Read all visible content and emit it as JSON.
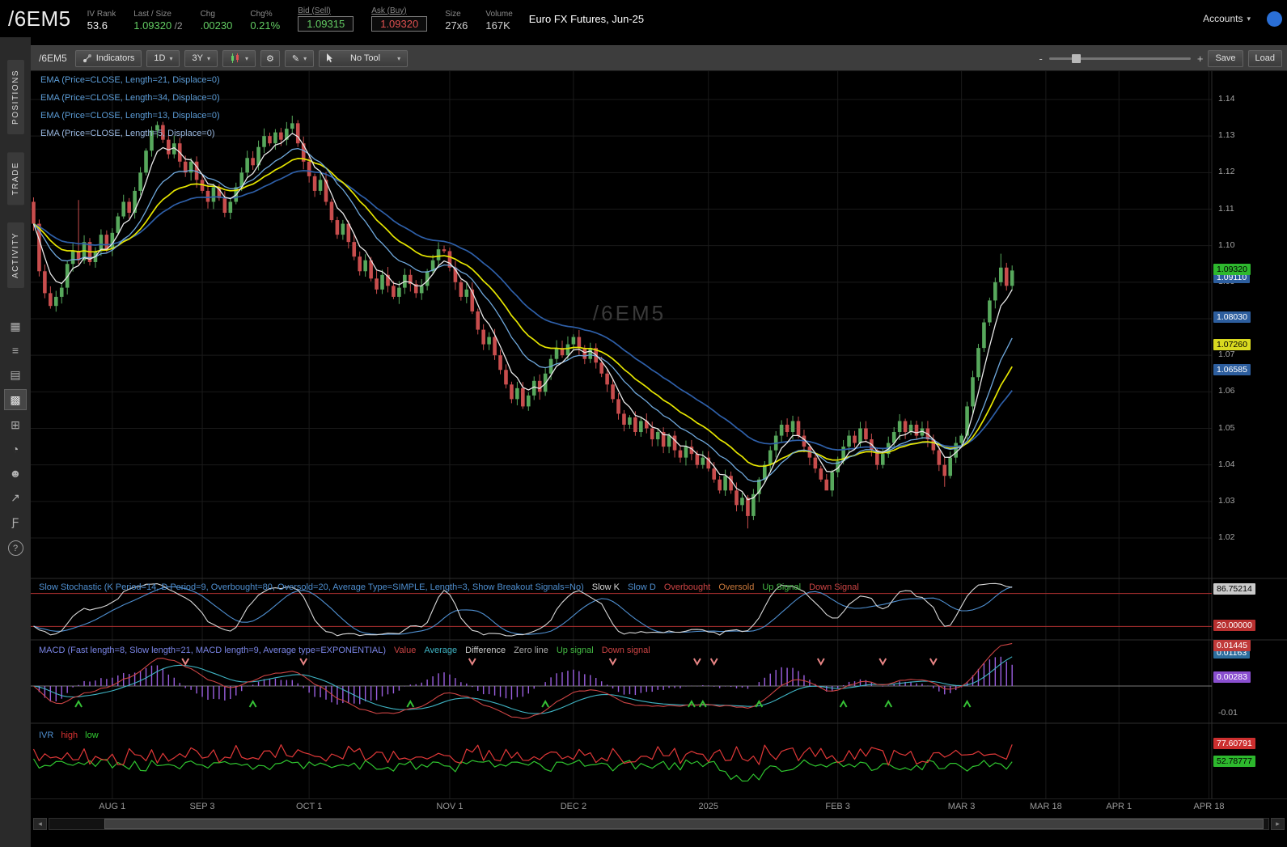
{
  "header": {
    "symbol": "/6EM5",
    "fields": [
      {
        "label": "IV Rank",
        "value": "53.6",
        "color": "white",
        "boxed": false
      },
      {
        "label": "Last / Size",
        "value": "1.09320",
        "suffix": " /2",
        "color": "green",
        "boxed": false
      },
      {
        "label": "Chg",
        "value": ".00230",
        "color": "green",
        "boxed": false
      },
      {
        "label": "Chg%",
        "value": "0.21%",
        "color": "green",
        "boxed": false
      },
      {
        "label": "Bid (Sell)",
        "value": "1.09315",
        "color": "green",
        "boxed": true
      },
      {
        "label": "Ask (Buy)",
        "value": "1.09320",
        "color": "red",
        "boxed": true
      },
      {
        "label": "Size",
        "value": "27x6",
        "color": "gray",
        "boxed": false
      },
      {
        "label": "Volume",
        "value": "167K",
        "color": "gray",
        "boxed": false
      }
    ],
    "description": "Euro FX Futures, Jun-25",
    "accounts_label": "Accounts"
  },
  "sidebar": {
    "tabs": [
      {
        "label": "POSITIONS"
      },
      {
        "label": "TRADE"
      },
      {
        "label": "ACTIVITY"
      }
    ],
    "icons": [
      {
        "name": "calculator-icon",
        "glyph": "▦"
      },
      {
        "name": "watchlist-icon",
        "glyph": "≡"
      },
      {
        "name": "notes-icon",
        "glyph": "▤"
      },
      {
        "name": "charts-icon",
        "glyph": "▩",
        "active": true
      },
      {
        "name": "apps-grid-icon",
        "glyph": "⊞"
      },
      {
        "name": "history-clock-icon",
        "glyph": "◔"
      },
      {
        "name": "community-icon",
        "glyph": "☻"
      },
      {
        "name": "share-export-icon",
        "glyph": "↗"
      },
      {
        "name": "fx-board-icon",
        "glyph": "Ƒ"
      },
      {
        "name": "help-icon",
        "glyph": "?",
        "round": true
      }
    ]
  },
  "toolbar": {
    "symbol": "/6EM5",
    "indicators_label": "Indicators",
    "timeframe": "1D",
    "range": "3Y",
    "tool_label": "No Tool",
    "save_label": "Save",
    "load_label": "Load"
  },
  "icons": {
    "chevron_down": "▾",
    "minus": "-",
    "plus": "+",
    "gear": "⚙",
    "pencil": "✎",
    "scroll_left": "◂",
    "scroll_right": "▸"
  },
  "watermark": "/6EM5",
  "legends": {
    "emas": [
      {
        "text": "EMA (Price=CLOSE, Length=21, Displace=0)",
        "color": "#5b9bd5"
      },
      {
        "text": "EMA (Price=CLOSE, Length=34, Displace=0)",
        "color": "#5b9bd5"
      },
      {
        "text": "EMA (Price=CLOSE, Length=13, Displace=0)",
        "color": "#5b9bd5"
      },
      {
        "text": "EMA (Price=CLOSE, Length=5, Displace=0)",
        "color": "#9ab8e0"
      }
    ],
    "stoch": [
      {
        "text": "Slow Stochastic (K Period=14, D Period=9, Overbought=80, Oversold=20, Average Type=SIMPLE, Length=3, Show Breakout Signals=No)",
        "color": "#4f8fd0"
      },
      {
        "text": "Slow K",
        "color": "#d8d8d8"
      },
      {
        "text": "Slow D",
        "color": "#4f8fd0"
      },
      {
        "text": "Overbought",
        "color": "#cc4444"
      },
      {
        "text": "Oversold",
        "color": "#cc7a3c"
      },
      {
        "text": "Up Signal",
        "color": "#44bb44"
      },
      {
        "text": "Down Signal",
        "color": "#cc4444"
      }
    ],
    "macd": [
      {
        "text": "MACD (Fast length=8, Slow length=21, MACD length=9, Average type=EXPONENTIAL)",
        "color": "#7b86e8"
      },
      {
        "text": "Value",
        "color": "#cc4444"
      },
      {
        "text": "Average",
        "color": "#3fb4c4"
      },
      {
        "text": "Difference",
        "color": "#cccccc"
      },
      {
        "text": "Zero line",
        "color": "#aaaaaa"
      },
      {
        "text": "Up signal",
        "color": "#44bb44"
      },
      {
        "text": "Down signal",
        "color": "#cc4444"
      }
    ],
    "ivr": [
      {
        "text": "IVR",
        "color": "#4f8fd0"
      },
      {
        "text": "high",
        "color": "#dd3333"
      },
      {
        "text": "low",
        "color": "#33cc33"
      }
    ]
  },
  "price_axis": {
    "ticks": [
      "1.14",
      "1.13",
      "1.12",
      "1.11",
      "1.10",
      "1.09",
      "1.08",
      "1.07",
      "1.06",
      "1.05",
      "1.04",
      "1.03",
      "1.02"
    ],
    "boxes": [
      {
        "label": "1.09320",
        "bg": "#2eb82e",
        "fg": "#000000"
      },
      {
        "label": "1.09110",
        "bg": "#2d5e9e",
        "fg": "#ffffff"
      },
      {
        "label": "1.08030",
        "bg": "#2d5e9e",
        "fg": "#ffffff"
      },
      {
        "label": "1.07260",
        "bg": "#d9d920",
        "fg": "#000000"
      },
      {
        "label": "1.06585",
        "bg": "#2d5e9e",
        "fg": "#ffffff"
      }
    ]
  },
  "stoch_axis": {
    "boxes": [
      {
        "label": "86.75214",
        "bg": "#c9c9c9",
        "fg": "#000000"
      },
      {
        "label": "20.00000",
        "bg": "#b93030",
        "fg": "#ffffff"
      }
    ]
  },
  "macd_axis": {
    "ticks": [
      "-0.01"
    ],
    "boxes": [
      {
        "label": "0.01445",
        "bg": "#c03a3a",
        "fg": "#ffffff"
      },
      {
        "label": "0.01163",
        "bg": "#2d6e9e",
        "fg": "#ffffff"
      },
      {
        "label": "0.00283",
        "bg": "#8a4fd0",
        "fg": "#ffffff"
      }
    ]
  },
  "ivr_axis": {
    "boxes": [
      {
        "label": "77.60791",
        "bg": "#cc2f2f",
        "fg": "#ffffff"
      },
      {
        "label": "52.78777",
        "bg": "#2db82d",
        "fg": "#000000"
      }
    ]
  },
  "chart_data": {
    "type": "candlestick",
    "symbol": "/6EM5",
    "timeframe": "1D",
    "range": "3Y",
    "price_range": [
      1.0095,
      1.1477
    ],
    "slots": 210,
    "candles_first_open": 1.112,
    "closes": [
      1.106,
      1.093,
      1.087,
      1.0835,
      1.086,
      1.0885,
      1.095,
      1.0985,
      1.096,
      1.101,
      1.0955,
      1.0985,
      1.103,
      1.099,
      1.1035,
      1.108,
      1.112,
      1.109,
      1.115,
      1.12,
      1.126,
      1.1315,
      1.133,
      1.129,
      1.125,
      1.128,
      1.123,
      1.12,
      1.123,
      1.118,
      1.115,
      1.112,
      1.116,
      1.113,
      1.109,
      1.112,
      1.116,
      1.12,
      1.124,
      1.122,
      1.127,
      1.13,
      1.128,
      1.131,
      1.129,
      1.132,
      1.1335,
      1.128,
      1.123,
      1.119,
      1.115,
      1.118,
      1.112,
      1.107,
      1.103,
      1.106,
      1.101,
      1.097,
      1.093,
      1.096,
      1.091,
      1.088,
      1.092,
      1.089,
      1.086,
      1.0885,
      1.092,
      1.0895,
      1.087,
      1.089,
      1.093,
      1.096,
      1.099,
      1.0985,
      1.094,
      1.09,
      1.086,
      1.088,
      1.082,
      1.077,
      1.073,
      1.075,
      1.07,
      1.066,
      1.062,
      1.058,
      1.061,
      1.056,
      1.059,
      1.063,
      1.06,
      1.065,
      1.069,
      1.072,
      1.07,
      1.073,
      1.075,
      1.072,
      1.069,
      1.072,
      1.068,
      1.065,
      1.062,
      1.058,
      1.054,
      1.051,
      1.053,
      1.049,
      1.052,
      1.05,
      1.047,
      1.049,
      1.045,
      1.048,
      1.044,
      1.042,
      1.045,
      1.043,
      1.04,
      1.042,
      1.039,
      1.036,
      1.033,
      1.037,
      1.033,
      1.029,
      1.031,
      1.026,
      1.032,
      1.036,
      1.04,
      1.044,
      1.048,
      1.051,
      1.049,
      1.052,
      1.048,
      1.045,
      1.042,
      1.039,
      1.036,
      1.033,
      1.038,
      1.041,
      1.045,
      1.048,
      1.046,
      1.05,
      1.047,
      1.044,
      1.04,
      1.043,
      1.046,
      1.049,
      1.052,
      1.049,
      1.051,
      1.048,
      1.05,
      1.047,
      1.044,
      1.04,
      1.037,
      1.042,
      1.046,
      1.048,
      1.056,
      1.064,
      1.072,
      1.079,
      1.085,
      1.09,
      1.094,
      1.089,
      1.0932
    ],
    "wick_overrides": {
      "8": {
        "high": 1.1125
      },
      "127": {
        "low": 1.0226
      },
      "141": {
        "low": 1.0335
      },
      "162": {
        "low": 1.034
      },
      "172": {
        "high": 1.0978
      }
    },
    "ema_lengths": [
      5,
      13,
      21,
      34
    ],
    "ema_colors": {
      "5": "#e8e8e8",
      "13": "#6fa8dc",
      "21": "#e6e600",
      "34": "#2e5fa8"
    },
    "stochastic": {
      "k_period": 14,
      "d_period": 9,
      "overbought": 80,
      "oversold": 20,
      "avg_length": 3
    },
    "macd": {
      "fast": 8,
      "slow": 21,
      "length": 9
    },
    "ivr_last": {
      "high": 77.60791,
      "low": 52.78777
    },
    "time_ticks": [
      {
        "label": "AUG 1",
        "slot": 14
      },
      {
        "label": "SEP 3",
        "slot": 30
      },
      {
        "label": "OCT 1",
        "slot": 49
      },
      {
        "label": "NOV 1",
        "slot": 74
      },
      {
        "label": "DEC 2",
        "slot": 96
      },
      {
        "label": "2025",
        "slot": 120
      },
      {
        "label": "FEB 3",
        "slot": 143
      },
      {
        "label": "MAR 3",
        "slot": 165
      },
      {
        "label": "MAR 18",
        "slot": 180
      },
      {
        "label": "APR 1",
        "slot": 193
      },
      {
        "label": "APR 18",
        "slot": 209
      }
    ]
  }
}
